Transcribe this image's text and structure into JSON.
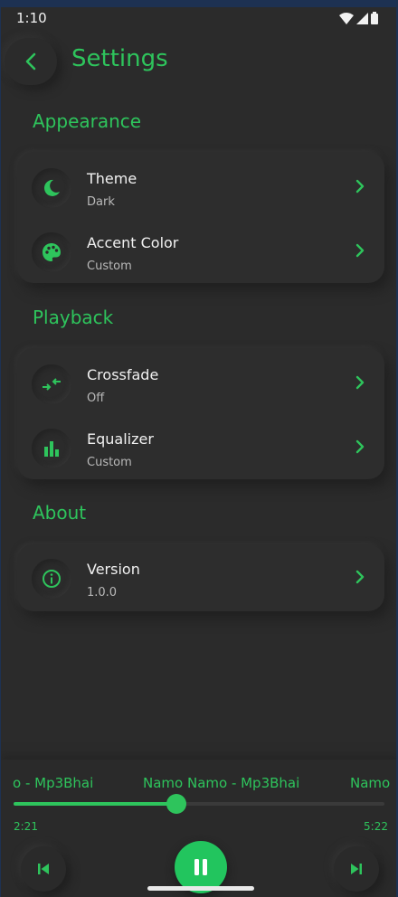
{
  "status_bar": {
    "time": "1:10"
  },
  "app_bar": {
    "title": "Settings"
  },
  "sections": [
    {
      "title": "Appearance",
      "items": [
        {
          "label": "Theme",
          "value": "Dark",
          "icon": "moon-icon"
        },
        {
          "label": "Accent Color",
          "value": "Custom",
          "icon": "palette-icon"
        }
      ]
    },
    {
      "title": "Playback",
      "items": [
        {
          "label": "Crossfade",
          "value": "Off",
          "icon": "crossfade-icon"
        },
        {
          "label": "Equalizer",
          "value": "Custom",
          "icon": "equalizer-icon"
        }
      ]
    },
    {
      "title": "About",
      "items": [
        {
          "label": "Version",
          "value": "1.0.0",
          "icon": "info-icon"
        }
      ]
    }
  ],
  "player": {
    "marquee_text": [
      "o - Mp3Bhai",
      "Namo Namo - Mp3Bhai",
      "Namo"
    ],
    "elapsed": "2:21",
    "duration": "5:22",
    "progress": 0.44,
    "state": "playing"
  },
  "colors": {
    "accent": "#2ec45c",
    "background": "#2b2b2b"
  }
}
